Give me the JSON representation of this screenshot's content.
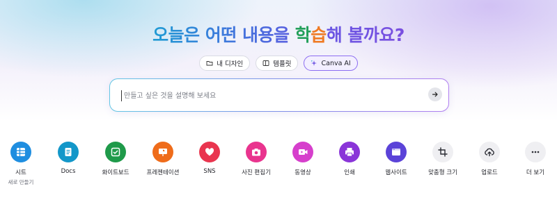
{
  "headline": {
    "prefix": "오늘은 어떤 내용을 ",
    "highlight_a": "학",
    "highlight_b": "습",
    "suffix": "해 볼까요?"
  },
  "chips": [
    {
      "label": "내 디자인",
      "icon": "folder-icon",
      "active": false
    },
    {
      "label": "템플릿",
      "icon": "template-icon",
      "active": false
    },
    {
      "label": "Canva AI",
      "icon": "sparkle-icon",
      "active": true
    }
  ],
  "search": {
    "placeholder": "만들고 싶은 것을 설명해 보세요",
    "submit_icon": "arrow-right-icon"
  },
  "shortcuts": [
    {
      "label": "시트",
      "sublabel": "새로 만들기",
      "icon": "sheet-icon",
      "color": "#1f8ee0"
    },
    {
      "label": "Docs",
      "icon": "docs-icon",
      "color": "#1397c9"
    },
    {
      "label": "화이트보드",
      "icon": "whiteboard-icon",
      "color": "#1f9a4a"
    },
    {
      "label": "프레젠테이션",
      "icon": "presentation-icon",
      "color": "#ef6c1a"
    },
    {
      "label": "SNS",
      "icon": "heart-icon",
      "color": "#e9354f"
    },
    {
      "label": "사진 편집기",
      "icon": "camera-icon",
      "color": "#e9348e"
    },
    {
      "label": "동영상",
      "icon": "video-icon",
      "color": "#d63fcc"
    },
    {
      "label": "인쇄",
      "icon": "printer-icon",
      "color": "#8a35d8"
    },
    {
      "label": "웹사이트",
      "icon": "website-icon",
      "color": "#5b43d8"
    },
    {
      "label": "맞춤형 크기",
      "icon": "crop-icon",
      "color": "#efeff2"
    },
    {
      "label": "업로드",
      "icon": "cloud-upload-icon",
      "color": "#efeff2"
    },
    {
      "label": "더 보기",
      "icon": "more-icon",
      "color": "#efeff2"
    }
  ]
}
